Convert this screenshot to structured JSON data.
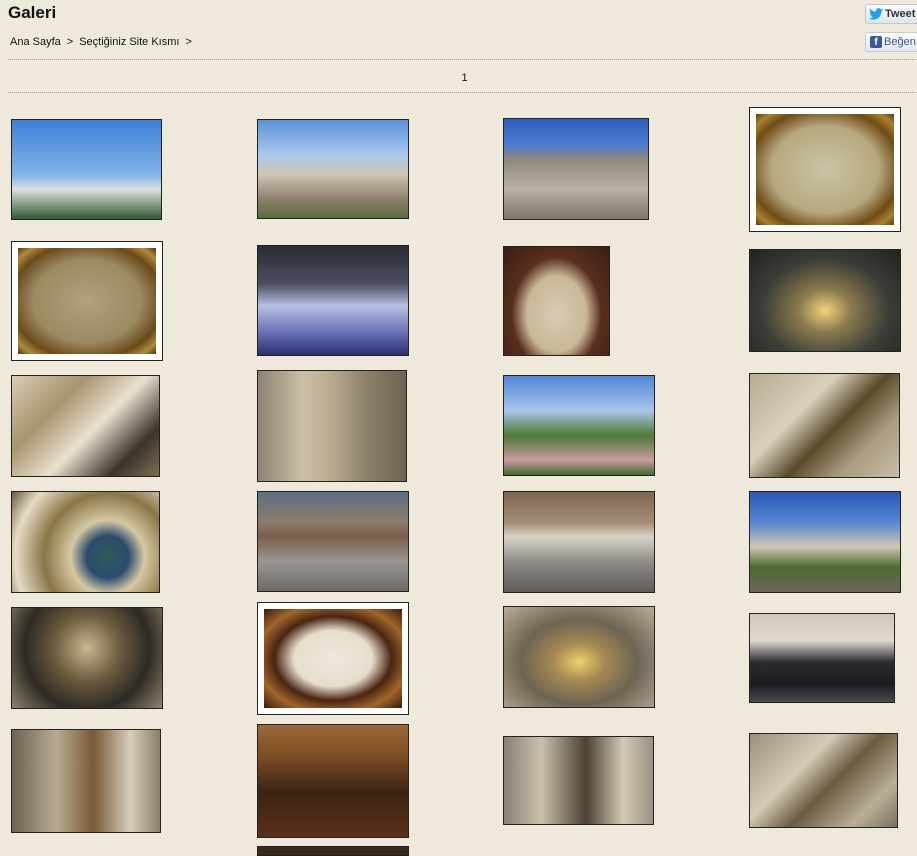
{
  "header": {
    "title": "Galeri",
    "tweet_label": "Tweet",
    "like_label": "Beğen"
  },
  "breadcrumb": [
    {
      "label": "Ana Sayfa"
    },
    {
      "label": ">"
    },
    {
      "label": "Seçtiğiniz Site Kısmı"
    },
    {
      "label": ">"
    }
  ],
  "pager": {
    "pages": [
      "1"
    ]
  },
  "gallery": {
    "thumbnails": [
      {
        "name": "thumb-mosque-minaret-sky",
        "icon": "photo-icon"
      },
      {
        "name": "thumb-mosque-courtyard-front",
        "icon": "photo-icon"
      },
      {
        "name": "thumb-gate-inscription",
        "icon": "photo-icon"
      },
      {
        "name": "thumb-painting-mecca",
        "icon": "photo-icon"
      },
      {
        "name": "thumb-painting-city",
        "icon": "photo-icon"
      },
      {
        "name": "thumb-crystal-mosque-model",
        "icon": "photo-icon"
      },
      {
        "name": "thumb-calligraphy-panel",
        "icon": "photo-icon"
      },
      {
        "name": "thumb-interior-chandelier",
        "icon": "photo-icon"
      },
      {
        "name": "thumb-dome-interior",
        "icon": "photo-icon"
      },
      {
        "name": "thumb-minbar-marble",
        "icon": "photo-icon"
      },
      {
        "name": "thumb-garden-roses",
        "icon": "photo-icon"
      },
      {
        "name": "thumb-minbar-cone",
        "icon": "photo-icon"
      },
      {
        "name": "thumb-dome-calligraphy-roundel",
        "icon": "photo-icon"
      },
      {
        "name": "thumb-courtyard-crowd",
        "icon": "photo-icon"
      },
      {
        "name": "thumb-courtyard-queue",
        "icon": "photo-icon"
      },
      {
        "name": "thumb-mosque-street-view",
        "icon": "photo-icon"
      },
      {
        "name": "thumb-dome-ceiling",
        "icon": "photo-icon"
      },
      {
        "name": "thumb-tughra-framed",
        "icon": "photo-icon"
      },
      {
        "name": "thumb-mihrab-chandelier",
        "icon": "photo-icon"
      },
      {
        "name": "thumb-group-portrait",
        "icon": "photo-icon"
      },
      {
        "name": "thumb-interior-pulpit",
        "icon": "photo-icon"
      },
      {
        "name": "thumb-office-flag",
        "icon": "photo-icon"
      },
      {
        "name": "thumb-window-wall",
        "icon": "photo-icon"
      },
      {
        "name": "thumb-muqarnas-minbar",
        "icon": "photo-icon"
      }
    ]
  },
  "colors": {
    "page_background": "#efe9dc",
    "divider": "#a89f8c",
    "twitter_blue": "#1da1f2",
    "facebook_blue": "#3b5998"
  }
}
